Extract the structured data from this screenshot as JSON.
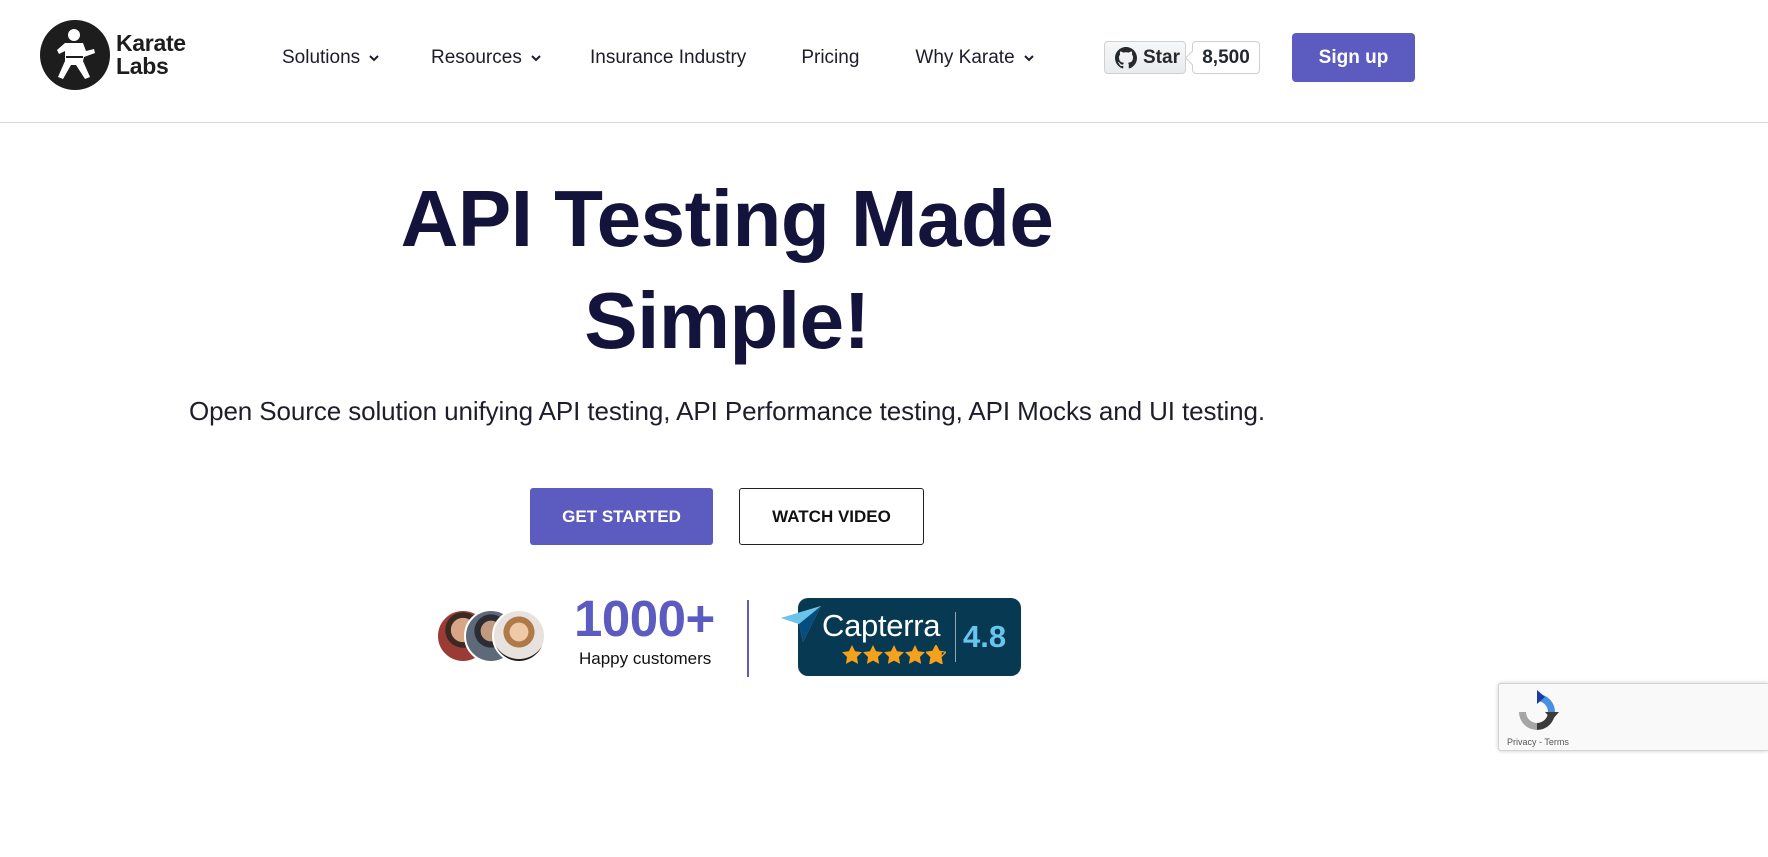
{
  "brand": {
    "name_line1": "Karate",
    "name_line2": "Labs"
  },
  "nav": {
    "items": [
      {
        "label": "Solutions",
        "has_dropdown": true
      },
      {
        "label": "Resources",
        "has_dropdown": true
      },
      {
        "label": "Insurance Industry",
        "has_dropdown": false
      },
      {
        "label": "Pricing",
        "has_dropdown": false
      },
      {
        "label": "Why Karate",
        "has_dropdown": true
      }
    ]
  },
  "github": {
    "star_label": "Star",
    "star_count": "8,500"
  },
  "header": {
    "signup_label": "Sign up"
  },
  "hero": {
    "title_line1": "API Testing Made",
    "title_line2": "Simple!",
    "subtitle": "Open Source solution unifying API testing, API Performance testing, API Mocks and UI testing.",
    "primary_cta": "GET STARTED",
    "secondary_cta": "WATCH VIDEO"
  },
  "social_proof": {
    "customer_count": "1000+",
    "customer_label": "Happy customers",
    "capterra_name": "Capterra",
    "capterra_rating": "4.8",
    "capterra_stars": 4.8
  },
  "recaptcha": {
    "privacy": "Privacy",
    "separator": " - ",
    "terms": "Terms"
  },
  "colors": {
    "accent": "#5b5bc0",
    "heading": "#14133b",
    "capterra_bg": "#073a52",
    "capterra_rating": "#68c5ed",
    "star": "#f6a11b"
  },
  "icons": {
    "logo": "karate-figure-icon",
    "dropdown": "chevron-down-icon",
    "github": "github-icon",
    "capterra": "capterra-arrow-icon",
    "star": "star-icon",
    "recaptcha": "recaptcha-icon"
  }
}
